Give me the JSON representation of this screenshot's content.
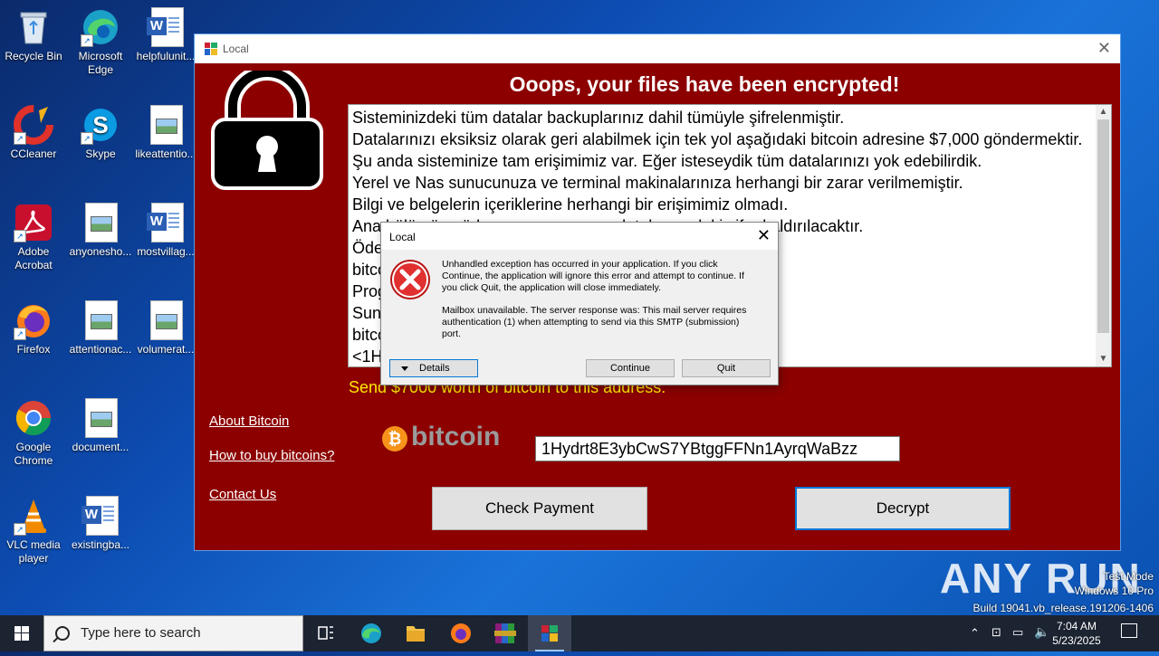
{
  "desktop": {
    "icons": [
      {
        "label": "Recycle Bin"
      },
      {
        "label": "Microsoft Edge"
      },
      {
        "label": "helpfulunit..."
      },
      {
        "label": "CCleaner"
      },
      {
        "label": "Skype"
      },
      {
        "label": "likeattentio..."
      },
      {
        "label": "Adobe Acrobat"
      },
      {
        "label": "anyonesho..."
      },
      {
        "label": "mostvillag..."
      },
      {
        "label": "Firefox"
      },
      {
        "label": "attentionac..."
      },
      {
        "label": "volumerat..."
      },
      {
        "label": "Google Chrome"
      },
      {
        "label": "document..."
      },
      {
        "label": "VLC media player"
      },
      {
        "label": "existingba..."
      }
    ]
  },
  "ransom_window": {
    "title": "Local",
    "headline": "Ooops, your files have been encrypted!",
    "message_lines": [
      "Sisteminizdeki tüm datalar backuplarınız dahil tümüyle şifrelenmiştir.",
      "Datalarınızı eksiksiz olarak geri alabilmek için tek yol aşağıdaki bitcoin adresine $7,000 göndermektir.",
      "Şu anda sisteminize tam erişimimiz var. Eğer isteseydik tüm datalarınızı yok edebilirdik.",
      "Yerel ve Nas sunucunuza ve terminal makinalarınıza herhangi bir zarar verilmemiştir.",
      "Bilgi ve belgelerin içeriklerine herhangi bir erişimimiz olmadı.",
      "Ana bölümü ... ödeme yapmazsanız datalarınızdaki şifre kaldırılacaktır.",
      "Öde... açmaktan geri durmayacağız.",
      "bitco... butonuna tıklamanız yeterli.",
      "Prog...",
      "Sun...",
      "bitco... nu aktif olacaktır.",
      "<1H..."
    ],
    "send_label": "Send $7000 worth of bitcoin to this address:",
    "links": {
      "about": "About Bitcoin",
      "how_to_buy": "How to buy bitcoins?",
      "contact": "Contact Us"
    },
    "bitcoin_logo_text": "bitcoin",
    "address": "1Hydrt8E3ybCwS7YBtggFFNn1AyrqWaBzz",
    "check_payment_label": "Check Payment",
    "decrypt_label": "Decrypt",
    "colors": {
      "background": "#8c0000",
      "send_label": "#ffea00"
    }
  },
  "error_dialog": {
    "title": "Local",
    "message1": "Unhandled exception has occurred in your application. If you click Continue, the application will ignore this error and attempt to continue. If you click Quit, the application will close immediately.",
    "message2": "Mailbox unavailable. The server response was: This mail server requires authentication (1) when attempting to send via this SMTP (submission) port.",
    "details_label": "Details",
    "continue_label": "Continue",
    "quit_label": "Quit"
  },
  "taskbar": {
    "search_placeholder": "Type here to search",
    "time": "7:04 AM",
    "date": "5/23/2025"
  },
  "watermark": {
    "line1": "Test Mode",
    "line2": "Windows 10 Pro",
    "line3": "Build 19041.vb_release.191206-1406",
    "brand": "ANY RUN"
  }
}
